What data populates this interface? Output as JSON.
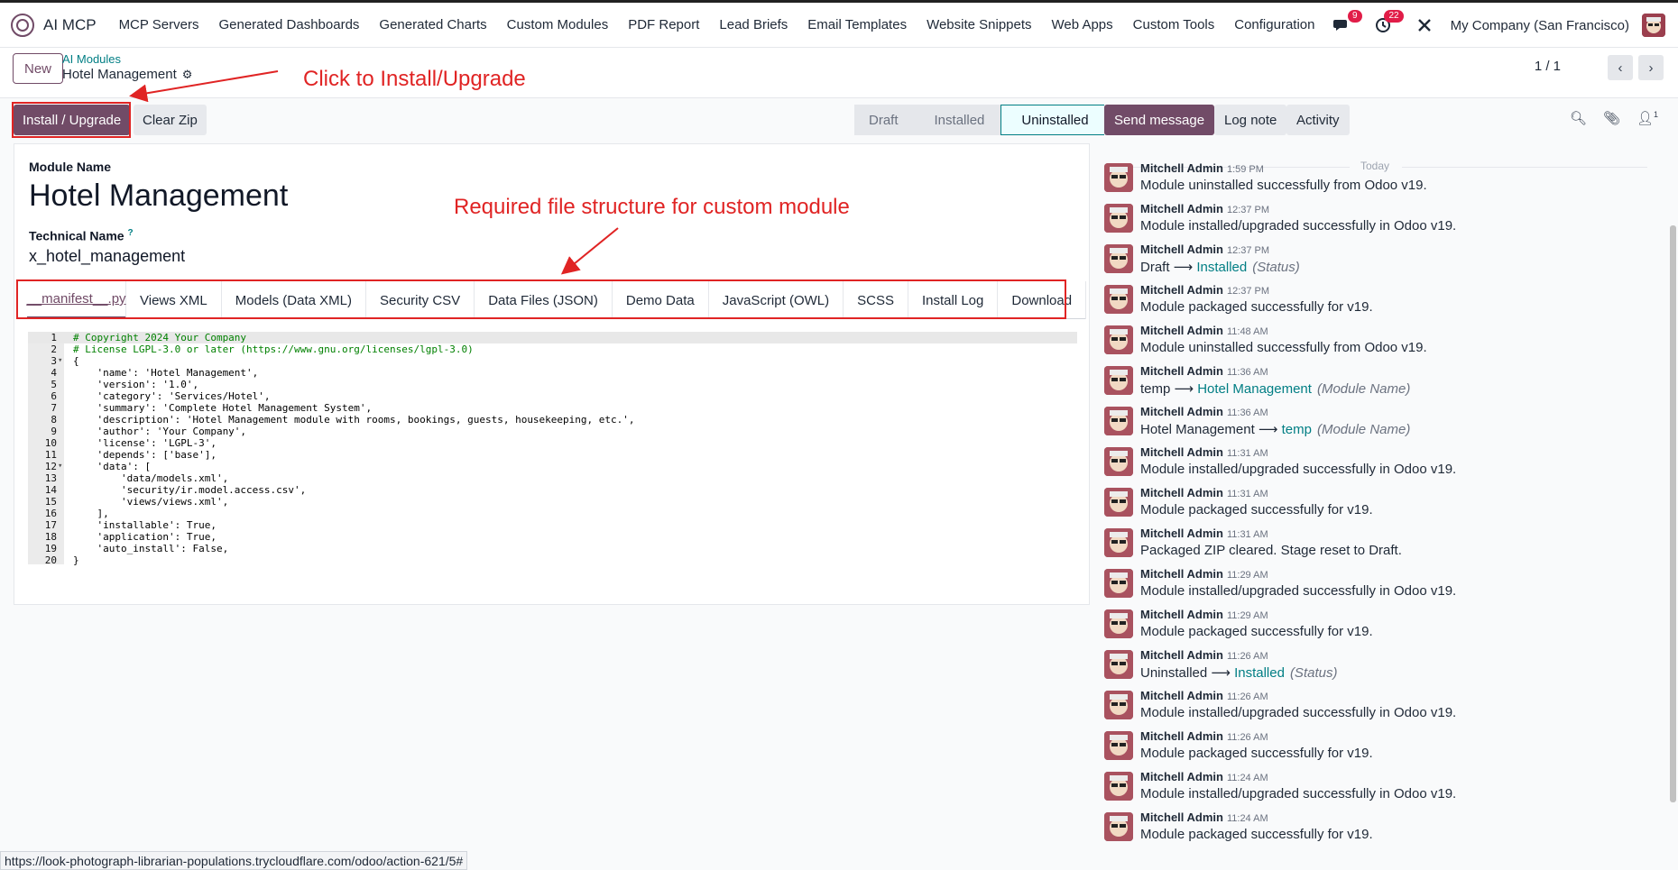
{
  "nav": {
    "brand": "AI MCP",
    "menu": [
      "MCP Servers",
      "Generated Dashboards",
      "Generated Charts",
      "Custom Modules",
      "PDF Report",
      "Lead Briefs",
      "Email Templates",
      "Website Snippets",
      "Web Apps",
      "Custom Tools",
      "Configuration"
    ],
    "chat_badge": "9",
    "activity_badge": "22",
    "company": "My Company (San Francisco)"
  },
  "control": {
    "new_label": "New",
    "breadcrumb_parent": "AI Modules",
    "breadcrumb_current": "Hotel Management",
    "pager": "1 / 1"
  },
  "actions": {
    "install_label": "Install / Upgrade",
    "clear_zip_label": "Clear Zip"
  },
  "stages": [
    "Draft",
    "Installed",
    "Uninstalled"
  ],
  "active_stage": "Uninstalled",
  "form": {
    "module_name_label": "Module Name",
    "module_name": "Hotel Management",
    "technical_name_label": "Technical Name",
    "technical_name_help": "?",
    "technical_name": "x_hotel_management",
    "tabs": [
      "__manifest__.py",
      "Views XML",
      "Models (Data XML)",
      "Security CSV",
      "Data Files (JSON)",
      "Demo Data",
      "JavaScript (OWL)",
      "SCSS",
      "Install Log",
      "Download"
    ],
    "active_tab": "__manifest__.py"
  },
  "code_lines": [
    "# Copyright 2024 Your Company",
    "# License LGPL-3.0 or later (https://www.gnu.org/licenses/lgpl-3.0)",
    "{",
    "    'name': 'Hotel Management',",
    "    'version': '1.0',",
    "    'category': 'Services/Hotel',",
    "    'summary': 'Complete Hotel Management System',",
    "    'description': 'Hotel Management module with rooms, bookings, guests, housekeeping, etc.',",
    "    'author': 'Your Company',",
    "    'license': 'LGPL-3',",
    "    'depends': ['base'],",
    "    'data': [",
    "        'data/models.xml',",
    "        'security/ir.model.access.csv',",
    "        'views/views.xml',",
    "    ],",
    "    'installable': True,",
    "    'application': True,",
    "    'auto_install': False,",
    "}"
  ],
  "chatter": {
    "send_message_label": "Send message",
    "log_note_label": "Log note",
    "activity_label": "Activity",
    "followers_count": "1",
    "today_label": "Today",
    "messages": [
      {
        "author": "Mitchell Admin",
        "time": "1:59 PM",
        "body": "Module uninstalled successfully from Odoo v19."
      },
      {
        "author": "Mitchell Admin",
        "time": "12:37 PM",
        "body": "Module installed/upgraded successfully in Odoo v19."
      },
      {
        "author": "Mitchell Admin",
        "time": "12:37 PM",
        "old": "Draft",
        "new": "Installed",
        "field": "(Status)"
      },
      {
        "author": "Mitchell Admin",
        "time": "12:37 PM",
        "body": "Module packaged successfully for v19."
      },
      {
        "author": "Mitchell Admin",
        "time": "11:48 AM",
        "body": "Module uninstalled successfully from Odoo v19."
      },
      {
        "author": "Mitchell Admin",
        "time": "11:36 AM",
        "old": "temp",
        "new": "Hotel Management",
        "field": "(Module Name)"
      },
      {
        "author": "Mitchell Admin",
        "time": "11:36 AM",
        "old": "Hotel Management",
        "new": "temp",
        "field": "(Module Name)"
      },
      {
        "author": "Mitchell Admin",
        "time": "11:31 AM",
        "body": "Module installed/upgraded successfully in Odoo v19."
      },
      {
        "author": "Mitchell Admin",
        "time": "11:31 AM",
        "body": "Module packaged successfully for v19."
      },
      {
        "author": "Mitchell Admin",
        "time": "11:31 AM",
        "body": "Packaged ZIP cleared. Stage reset to Draft."
      },
      {
        "author": "Mitchell Admin",
        "time": "11:29 AM",
        "body": "Module installed/upgraded successfully in Odoo v19."
      },
      {
        "author": "Mitchell Admin",
        "time": "11:29 AM",
        "body": "Module packaged successfully for v19."
      },
      {
        "author": "Mitchell Admin",
        "time": "11:26 AM",
        "old": "Uninstalled",
        "new": "Installed",
        "field": "(Status)"
      },
      {
        "author": "Mitchell Admin",
        "time": "11:26 AM",
        "body": "Module installed/upgraded successfully in Odoo v19."
      },
      {
        "author": "Mitchell Admin",
        "time": "11:26 AM",
        "body": "Module packaged successfully for v19."
      },
      {
        "author": "Mitchell Admin",
        "time": "11:24 AM",
        "body": "Module installed/upgraded successfully in Odoo v19."
      },
      {
        "author": "Mitchell Admin",
        "time": "11:24 AM",
        "body": "Module packaged successfully for v19."
      }
    ]
  },
  "status_url": "https://look-photograph-librarian-populations.trycloudflare.com/odoo/action-621/5#",
  "annotations": {
    "install_hint": "Click to Install/Upgrade",
    "structure_hint": "Required file structure for custom module"
  },
  "colors": {
    "brand_primary": "#714b67",
    "link_teal": "#017e84",
    "annotation_red": "#e02424"
  }
}
